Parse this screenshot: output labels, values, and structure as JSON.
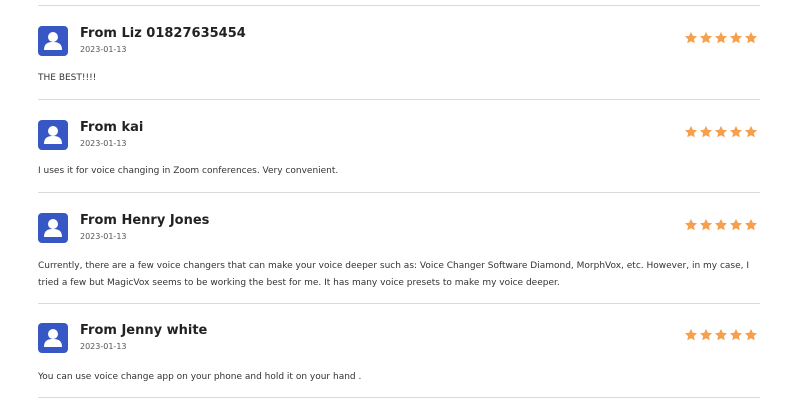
{
  "accent": {
    "avatar_bg": "#3657c4",
    "star_color": "#f6a04d"
  },
  "reviews": [
    {
      "author": "From Liz 01827635454",
      "date": "2023-01-13",
      "rating": 5,
      "text": "THE BEST!!!!"
    },
    {
      "author": "From kai",
      "date": "2023-01-13",
      "rating": 5,
      "text": "I uses it for voice changing in Zoom conferences. Very convenient."
    },
    {
      "author": "From Henry Jones",
      "date": "2023-01-13",
      "rating": 5,
      "text": "Currently, there are a few voice changers that can make your voice deeper such as: Voice Changer Software Diamond, MorphVox, etc. However, in my case, I tried a few but MagicVox seems to be working the best for me. It has many voice presets to make my voice deeper."
    },
    {
      "author": "From Jenny white",
      "date": "2023-01-13",
      "rating": 5,
      "text": "You can use voice change app on your phone and hold it on your hand ."
    }
  ]
}
